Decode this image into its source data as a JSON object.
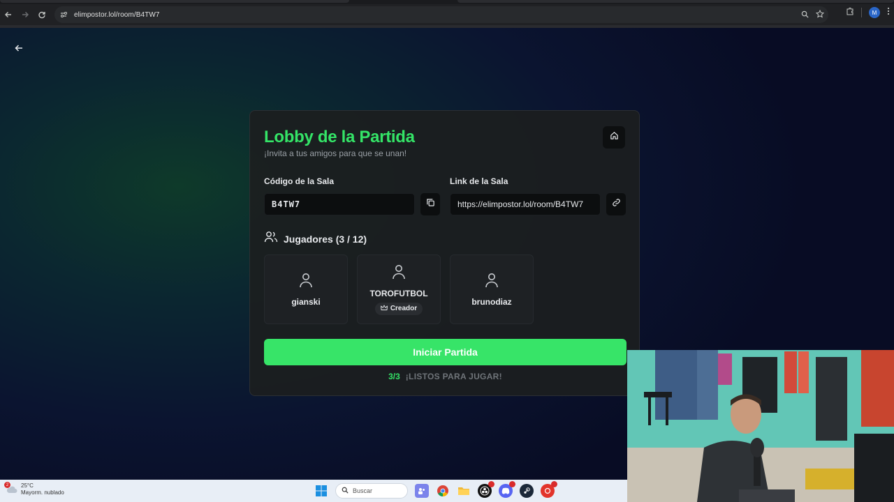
{
  "browser": {
    "url": "elimpostor.lol/room/B4TW7",
    "profile_initial": "M"
  },
  "card": {
    "title": "Lobby de la Partida",
    "subtitle": "¡Invita a tus amigos para que se unan!",
    "code_label": "Código de la Sala",
    "code_value": "B4TW7",
    "link_label": "Link de la Sala",
    "link_value": "https://elimpostor.lol/room/B4TW7",
    "players_title": "Jugadores (3 / 12)",
    "players": [
      {
        "name": "gianski"
      },
      {
        "name": "TOROFUTBOL",
        "badge": "Creador"
      },
      {
        "name": "brunodiaz"
      }
    ],
    "start_label": "Iniciar Partida",
    "ready_count": "3/3",
    "ready_text": "¡LISTOS PARA JUGAR!"
  },
  "taskbar": {
    "weather_badge": "2",
    "temperature": "25°C",
    "weather_desc": "Mayorm. nublado",
    "search_placeholder": "Buscar"
  },
  "colors": {
    "accent": "#37e468",
    "card_bg": "#1c1e20",
    "page_bg": "#0b0f1c"
  }
}
